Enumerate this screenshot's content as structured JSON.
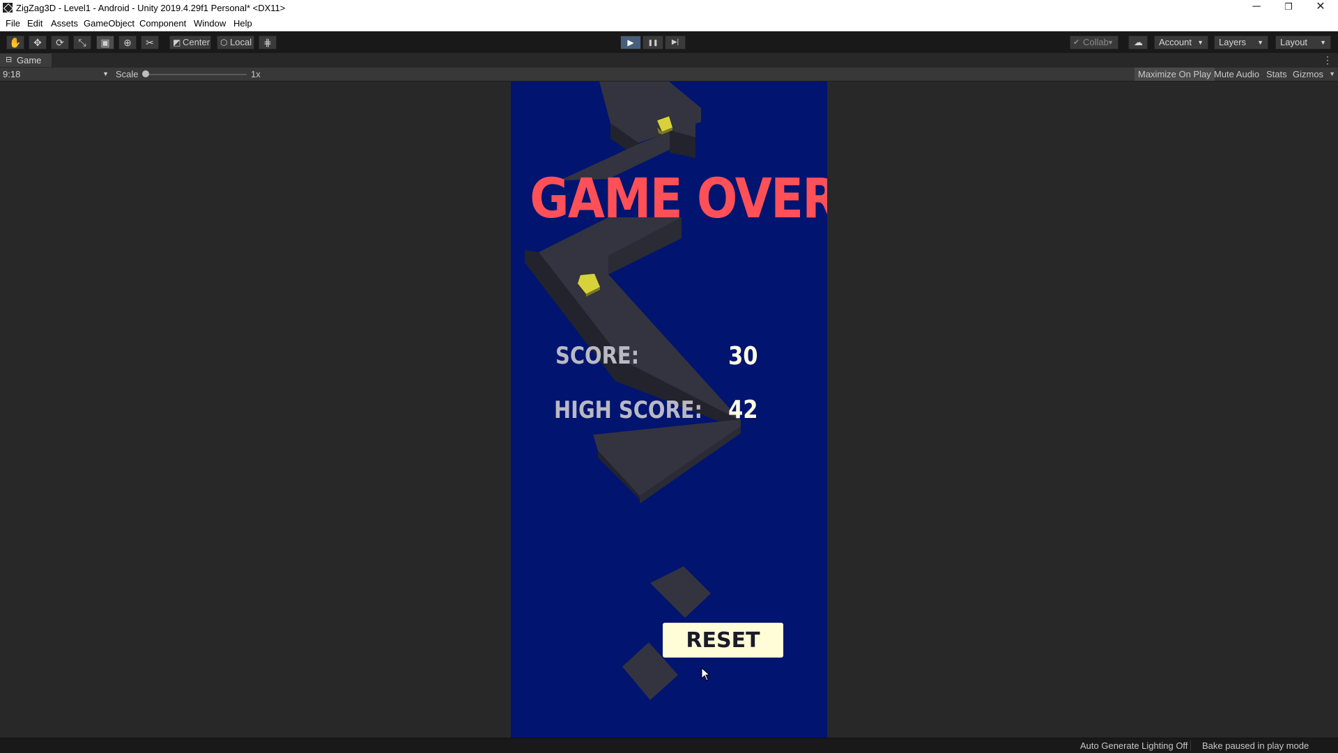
{
  "window": {
    "title": "ZigZag3D - Level1 - Android - Unity 2019.4.29f1 Personal* <DX11>",
    "minimize": "─",
    "restore": "❐",
    "close": "✕"
  },
  "menu": [
    "File",
    "Edit",
    "Assets",
    "GameObject",
    "Component",
    "Window",
    "Help"
  ],
  "toolbar": {
    "tools": [
      {
        "name": "hand-tool-icon",
        "glyph": "✋"
      },
      {
        "name": "move-tool-icon",
        "glyph": "✥"
      },
      {
        "name": "rotate-tool-icon",
        "glyph": "⟳"
      },
      {
        "name": "scale-tool-icon",
        "glyph": "⤡"
      },
      {
        "name": "rect-tool-icon",
        "glyph": "▣"
      },
      {
        "name": "transform-tool-icon",
        "glyph": "⊕"
      },
      {
        "name": "custom-tool-icon",
        "glyph": "✂"
      }
    ],
    "pivot_label": "Center",
    "rotation_label": "Local",
    "grid_glyph": "⋕",
    "play_glyph": "▶",
    "pause_glyph": "❚❚",
    "step_glyph": "▶|",
    "collab_label": "Collab",
    "cloud_glyph": "☁",
    "account_label": "Account",
    "layers_label": "Layers",
    "layout_label": "Layout"
  },
  "game_tab": {
    "label": "Game",
    "icon": "gamepad-icon",
    "menu_glyph": "⋮"
  },
  "game_controls": {
    "aspect": "9:18",
    "scale_label": "Scale",
    "scale_value": "1x",
    "scale_level": 0.0,
    "maximize_on_play": "Maximize On Play",
    "mute_audio": "Mute Audio",
    "stats": "Stats",
    "gizmos": "Gizmos"
  },
  "game_ui": {
    "title": "GAME OVER!",
    "score_label": "SCORE:",
    "score_value": "30",
    "high_score_label": "HIGH SCORE:",
    "high_score_value": "42",
    "reset_label": "RESET"
  },
  "colors": {
    "sky": "#001470",
    "path_top": "#33343f",
    "path_side": "#22232c",
    "gem": "#d8d23a",
    "title": "#ff5058",
    "reset_bg": "#fffdd7"
  },
  "status": {
    "lighting": "Auto Generate Lighting Off",
    "bake": "Bake paused in play mode"
  }
}
